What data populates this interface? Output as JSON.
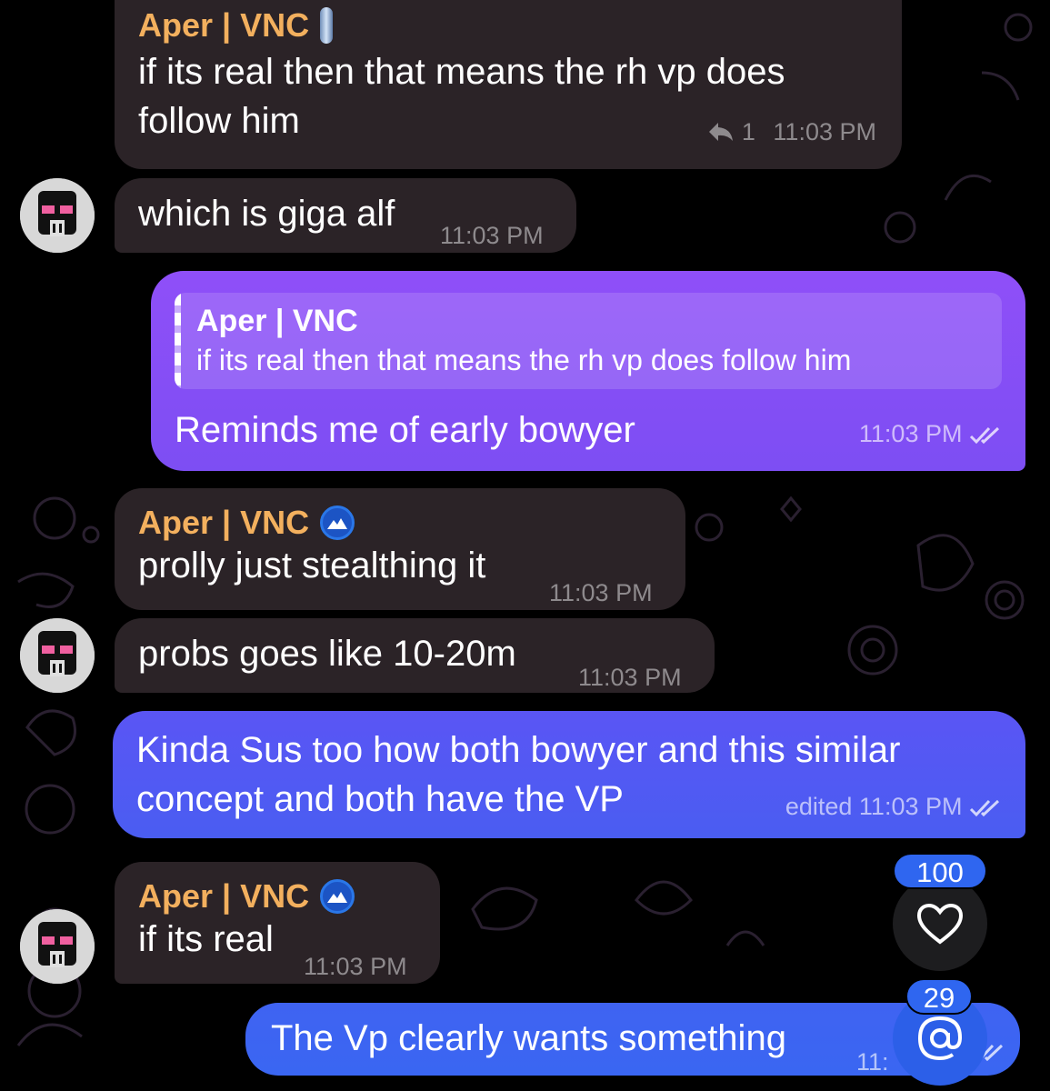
{
  "messages": [
    {
      "sender": "Aper | VNC",
      "text_line1": "if its real then that means the rh vp does",
      "text_line2": "follow him",
      "replies": "1",
      "time": "11:03 PM"
    },
    {
      "text": "which is giga alf",
      "time": "11:03 PM"
    },
    {
      "quote_author": "Aper | VNC",
      "quote_text": "if its real then that means the rh vp does follow him",
      "text": "Reminds me of early bowyer",
      "time": "11:03 PM"
    },
    {
      "sender": "Aper | VNC",
      "text": "prolly just stealthing it",
      "time": "11:03 PM"
    },
    {
      "text": "probs goes like 10-20m",
      "time": "11:03 PM"
    },
    {
      "text_line1": "Kinda Sus too how both bowyer and this similar",
      "text_line2": "concept and both have the VP",
      "time": "edited 11:03 PM"
    },
    {
      "sender": "Aper | VNC",
      "text": "if its real",
      "time": "11:03 PM"
    },
    {
      "text": "The Vp clearly wants something",
      "time": "11:"
    }
  ],
  "reactions_button": {
    "count": "100",
    "icon": "heart-icon"
  },
  "mentions_button": {
    "count": "29",
    "icon": "at-icon"
  },
  "colors": {
    "incoming_bubble": "#2b2327",
    "outgoing_purple": "#8a4cf6",
    "outgoing_blue": "#4b5cf2",
    "sender_name": "#f3b05e",
    "counter_badge": "#2f66f0"
  }
}
